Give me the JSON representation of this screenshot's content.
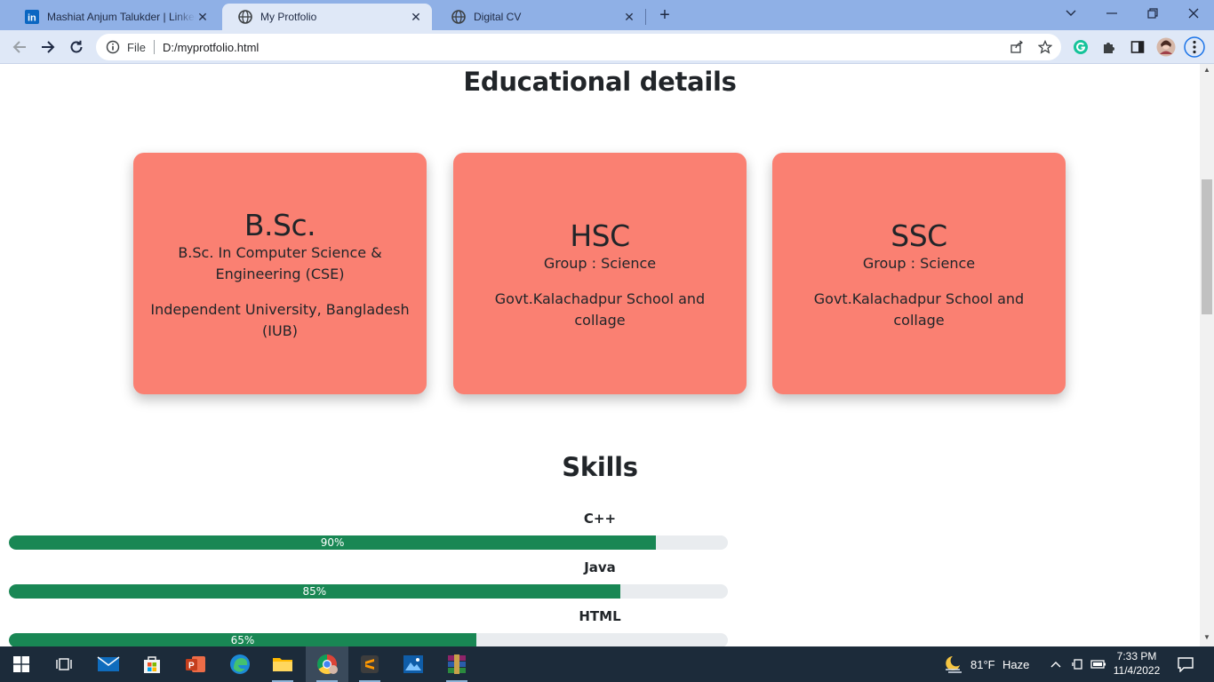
{
  "browser": {
    "tabs": [
      {
        "title": "Mashiat Anjum Talukder | LinkedIn",
        "icon": "linkedin-icon",
        "active": false
      },
      {
        "title": "My Protfolio",
        "icon": "globe-icon",
        "active": true
      },
      {
        "title": "Digital CV",
        "icon": "globe-icon",
        "active": false
      }
    ],
    "omnibox": {
      "scheme_label": "File",
      "url": "D:/myprotfolio.html"
    }
  },
  "page": {
    "education": {
      "heading": "Educational details",
      "cards": [
        {
          "title": "B.Sc.",
          "line1": "B.Sc. In Computer Science & Engineering (CSE)",
          "institution": "Independent University, Bangladesh (IUB)"
        },
        {
          "title": "HSC",
          "line1": "Group : Science",
          "institution": "Govt.Kalachadpur School and collage"
        },
        {
          "title": "SSC",
          "line1": "Group : Science",
          "institution": "Govt.Kalachadpur School and collage"
        }
      ],
      "card_color": "#fa8072"
    },
    "skills": {
      "heading": "Skills",
      "items": [
        {
          "name": "C++",
          "percent": 90,
          "label": "90%"
        },
        {
          "name": "Java",
          "percent": 85,
          "label": "85%"
        },
        {
          "name": "HTML",
          "percent": 65,
          "label": "65%"
        }
      ],
      "bar_color": "#198754"
    }
  },
  "taskbar": {
    "weather": {
      "temp": "81°F",
      "condition": "Haze"
    },
    "clock": {
      "time": "7:33 PM",
      "date": "11/4/2022"
    }
  }
}
